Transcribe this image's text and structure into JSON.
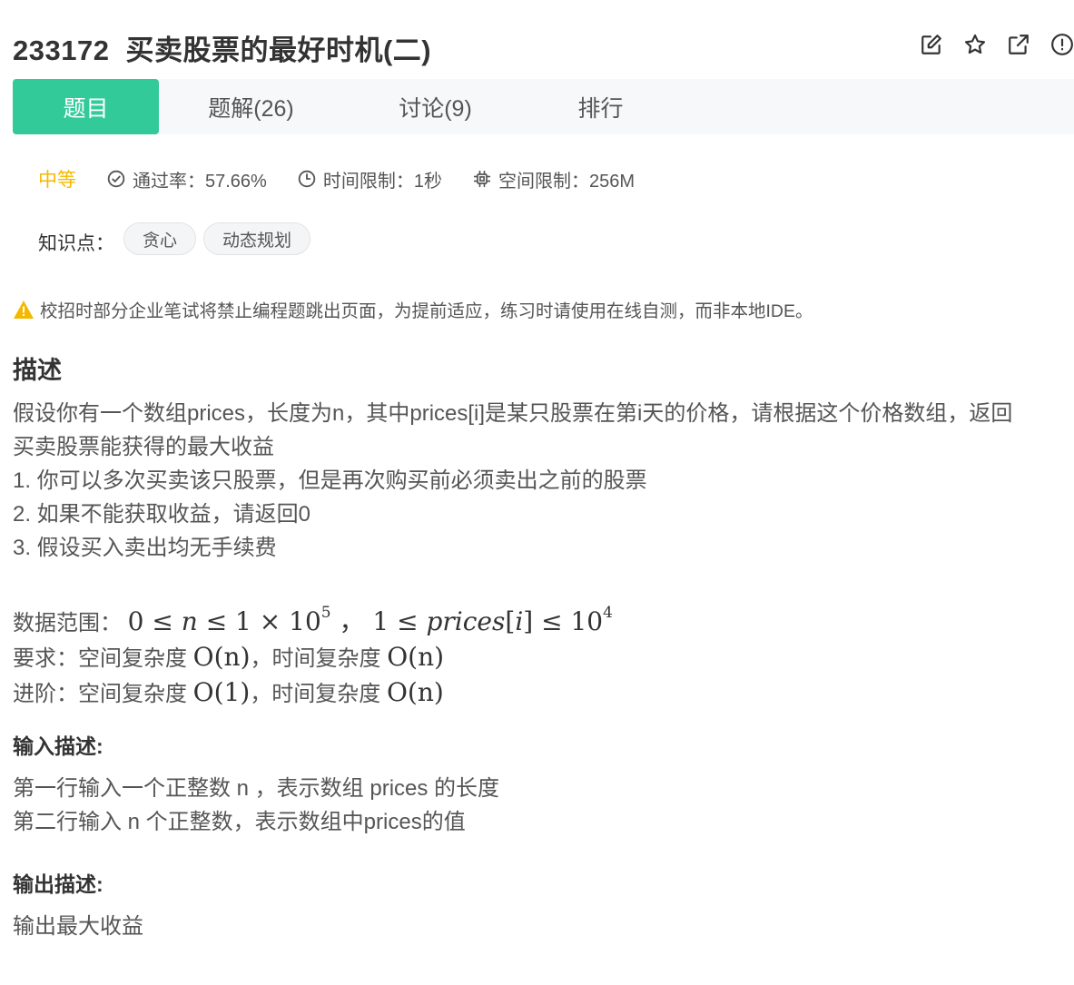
{
  "problem": {
    "id": "233172",
    "title": "买卖股票的最好时机(二)"
  },
  "header_icons": [
    "edit-icon",
    "star-icon",
    "external-link-icon",
    "report-icon"
  ],
  "tabs": [
    {
      "label": "题目",
      "active": true
    },
    {
      "label": "题解(26)",
      "active": false
    },
    {
      "label": "讨论(9)",
      "active": false
    },
    {
      "label": "排行",
      "active": false
    }
  ],
  "meta": {
    "difficulty": "中等",
    "pass_rate": "通过率：57.66%",
    "time_limit": "时间限制：1秒",
    "space_limit": "空间限制：256M"
  },
  "tags": {
    "label": "知识点：",
    "items": [
      "贪心",
      "动态规划"
    ]
  },
  "warning": "校招时部分企业笔试将禁止编程题跳出页面，为提前适应，练习时请使用在线自测，而非本地IDE。",
  "description": {
    "heading": "描述",
    "line1": "假设你有一个数组prices，长度为n，其中prices[i]是某只股票在第i天的价格，请根据这个价格数组，返回",
    "line2": "买卖股票能获得的最大收益",
    "line3": "1. 你可以多次买卖该只股票，但是再次购买前必须卖出之前的股票",
    "line4": "2. 如果不能获取收益，请返回0",
    "line5": "3. 假设买入卖出均无手续费",
    "range_label": "数据范围：",
    "range_math": "0 ≤ n ≤ 1 × 10^5 ， 1 ≤ prices[i] ≤ 10^4",
    "req_label": "要求：空间复杂度",
    "req_space": "O(n)",
    "req_mid": "，时间复杂度",
    "req_time": "O(n)",
    "adv_label": "进阶：空间复杂度",
    "adv_space": "O(1)",
    "adv_mid": "，时间复杂度",
    "adv_time": "O(n)"
  },
  "input": {
    "heading": "输入描述:",
    "line1": "第一行输入一个正整数 n ，表示数组 prices 的长度",
    "line2": "第二行输入 n 个正整数，表示数组中prices的值"
  },
  "output": {
    "heading": "输出描述:",
    "line1": "输出最大收益"
  },
  "colors": {
    "accent": "#32ca99",
    "difficulty": "#f5b800",
    "warning": "#f5b800"
  }
}
